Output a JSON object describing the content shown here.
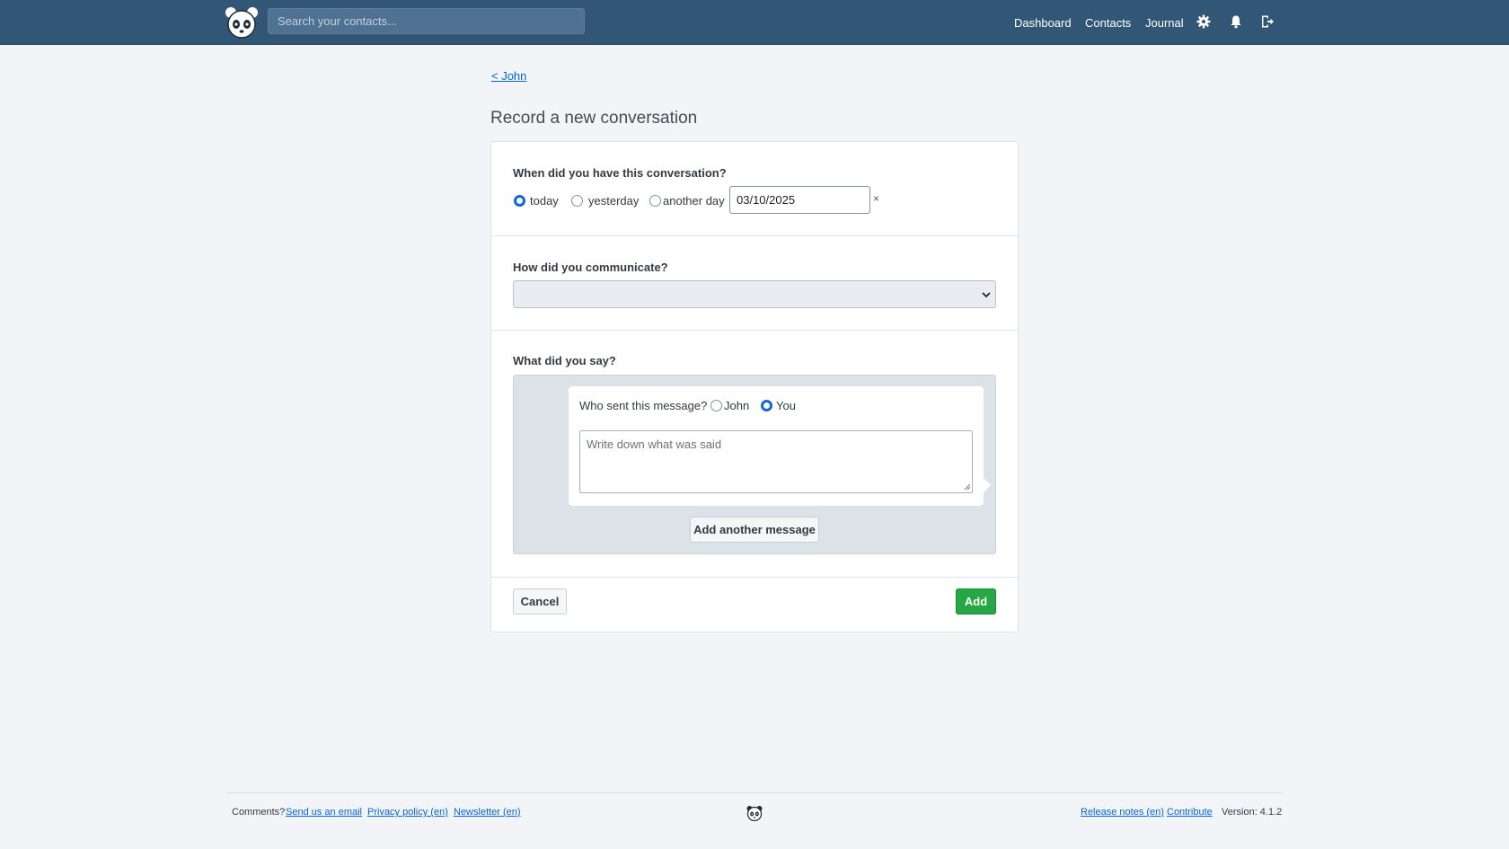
{
  "header": {
    "search_placeholder": "Search your contacts...",
    "nav": {
      "dashboard": "Dashboard",
      "contacts": "Contacts",
      "journal": "Journal"
    }
  },
  "breadcrumb": {
    "back": "< John"
  },
  "page": {
    "title": "Record a new conversation"
  },
  "form": {
    "when": {
      "label": "When did you have this conversation?",
      "options": [
        "today",
        "yesterday",
        "another day"
      ],
      "selected": "today",
      "date_value": "03/10/2025",
      "clear": "×"
    },
    "how": {
      "label": "How did you communicate?",
      "selected": ""
    },
    "what": {
      "label": "What did you say?",
      "who_label": "Who sent this message?",
      "senders": [
        "John",
        "You"
      ],
      "selected_sender": "You",
      "message_placeholder": "Write down what was said",
      "add_message": "Add another message"
    },
    "cancel": "Cancel",
    "submit": "Add"
  },
  "footer": {
    "comments": "Comments?",
    "send_email": "Send us an email",
    "privacy": "Privacy policy (en)",
    "newsletter": "Newsletter (en)",
    "release_notes": "Release notes (en)",
    "contribute": "Contribute",
    "version": "Version: 4.1.2"
  },
  "colors": {
    "header_bg": "#325776",
    "link": "#0366d6",
    "primary": "#27a744",
    "radio_checked": "#1266d6"
  }
}
